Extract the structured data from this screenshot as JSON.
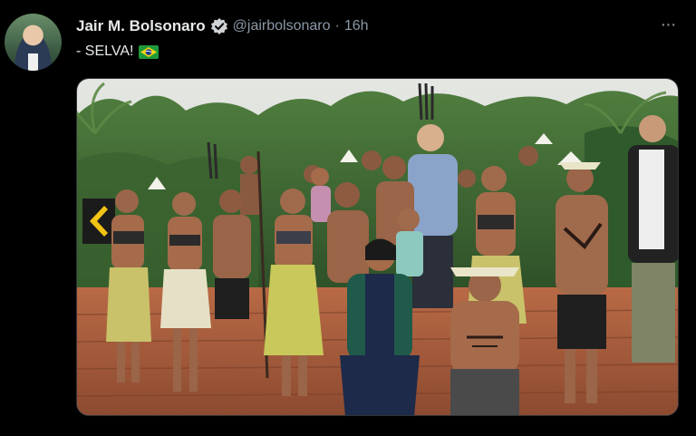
{
  "author": {
    "display_name": "Jair M. Bolsonaro",
    "handle": "@jairbolsonaro",
    "separator": "·",
    "time": "16h",
    "verified_icon": "verified-badge-icon"
  },
  "tweet": {
    "text": "- SELVA!",
    "emoji_icon": "brazil-flag-icon"
  },
  "menu": {
    "label": "···",
    "icon": "more-options-icon"
  },
  "media": {
    "description_icon": "photo",
    "colors": {
      "sky": "#d9dcd6",
      "foliage": "#3f6b34",
      "deck": "#a85a3a",
      "skin": "#a86a48"
    }
  }
}
